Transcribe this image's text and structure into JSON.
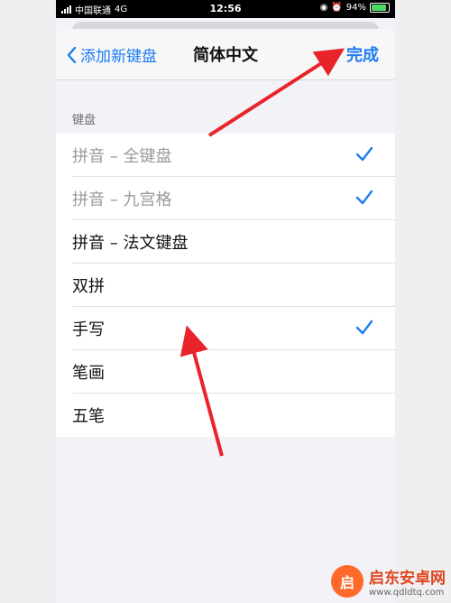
{
  "status_bar": {
    "carrier": "中国联通",
    "network": "4G",
    "time": "12:56",
    "battery": "94%"
  },
  "nav": {
    "back_label": "添加新键盘",
    "title": "简体中文",
    "done_label": "完成"
  },
  "section_label": "键盘",
  "keyboards": [
    {
      "label": "拼音 – 全键盘",
      "checked": true,
      "dimmed": true
    },
    {
      "label": "拼音 – 九宫格",
      "checked": true,
      "dimmed": true
    },
    {
      "label": "拼音 – 法文键盘",
      "checked": false,
      "dimmed": false
    },
    {
      "label": "双拼",
      "checked": false,
      "dimmed": false
    },
    {
      "label": "手写",
      "checked": true,
      "dimmed": false
    },
    {
      "label": "笔画",
      "checked": false,
      "dimmed": false
    },
    {
      "label": "五笔",
      "checked": false,
      "dimmed": false
    }
  ],
  "watermark": {
    "name": "启东安卓网",
    "url": "www.qdldtq.com"
  },
  "colors": {
    "accent": "#1e7cf0",
    "arrow": "#e8232a"
  }
}
